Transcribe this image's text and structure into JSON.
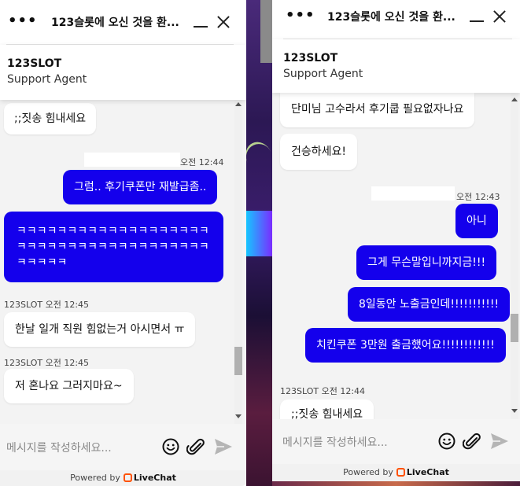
{
  "left": {
    "title": "123슬롯에 오신 것을 환...",
    "agent_name": "123SLOT",
    "agent_role": "Support Agent",
    "messages": [
      {
        "text": ";;짓송 힘내세요"
      },
      {
        "meta": "오전 12:44"
      },
      {
        "text": "그럼.. 후기쿠폰만 재발급좀.."
      },
      {
        "text": "ㅋㅋㅋㅋㅋㅋㅋㅋㅋㅋㅋㅋㅋㅋㅋㅋㅋㅋㅋㅋㅋㅋㅋㅋㅋㅋㅋㅋㅋㅋㅋㅋㅋㅋㅋㅋㅋㅋㅋㅋㅋㅋㅋ"
      },
      {
        "meta": "123SLOT 오전 12:45"
      },
      {
        "text": "한날 일개 직원 힘없는거 아시면서 ㅠ"
      },
      {
        "meta": "123SLOT 오전 12:45"
      },
      {
        "text": "저 혼나요 그러지마요~"
      }
    ],
    "composer_placeholder": "메시지를 작성하세요...",
    "powered_by": "Powered by",
    "brand": "LiveChat"
  },
  "right": {
    "title": "123슬롯에 오신 것을 환...",
    "agent_name": "123SLOT",
    "agent_role": "Support Agent",
    "messages": [
      {
        "text": "단미님 고수라서 후기쿱 필요없자나요"
      },
      {
        "text": "건승하세요!"
      },
      {
        "meta": "오전 12:43"
      },
      {
        "text": "아니"
      },
      {
        "text": "그게 무슨말입니까지금!!!"
      },
      {
        "text": "8일동안 노출금인데!!!!!!!!!!!"
      },
      {
        "text": "치킨쿠폰 3만원 출금했어요!!!!!!!!!!!!"
      },
      {
        "meta": "123SLOT 오전 12:44"
      },
      {
        "text": ";;짓송 힘내세요"
      }
    ],
    "composer_placeholder": "메시지를 작성하세요...",
    "powered_by": "Powered by",
    "brand": "LiveChat"
  },
  "icons": {
    "menu": "more-dots-icon",
    "minimize": "minimize-icon",
    "close": "close-icon",
    "emoji": "emoji-icon",
    "attach": "paperclip-icon",
    "send": "send-icon",
    "brand_logo": "livechat-logo-icon"
  },
  "colors": {
    "visitor_bubble": "#1400ec",
    "agent_bubble": "#ffffff",
    "thread_bg": "#f3f3f3",
    "brand_orange": "#ff5100"
  }
}
